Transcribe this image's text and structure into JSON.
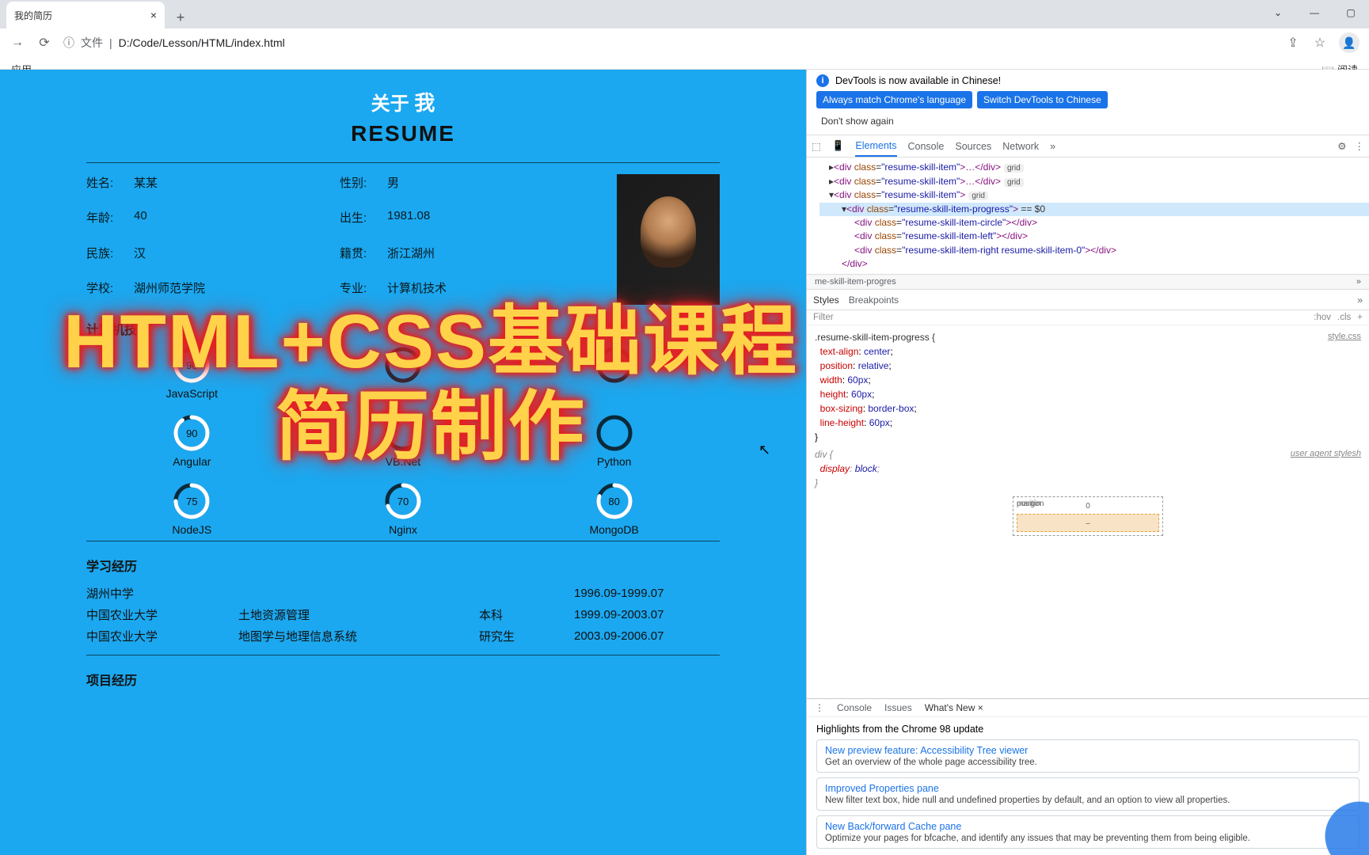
{
  "browser": {
    "tab_title": "我的简历",
    "url_prefix": "文件",
    "url_path": "D:/Code/Lesson/HTML/index.html",
    "bookmark_apps": "应用",
    "readlist": "阅读"
  },
  "resume": {
    "about_prefix": "关于",
    "about_me": "我",
    "title": "RESUME",
    "rows": [
      {
        "l1": "姓名:",
        "v1": "某某",
        "l2": "性别:",
        "v2": "男"
      },
      {
        "l1": "年龄:",
        "v1": "40",
        "l2": "出生:",
        "v2": "1981.08"
      },
      {
        "l1": "民族:",
        "v1": "汉",
        "l2": "籍贯:",
        "v2": "浙江湖州"
      },
      {
        "l1": "学校:",
        "v1": "湖州师范学院",
        "l2": "专业:",
        "v2": "计算机技术"
      }
    ],
    "skills_title": "计算机技能",
    "skills": [
      {
        "name": "JavaScript",
        "val": 90
      },
      {
        "name": "",
        "val": ""
      },
      {
        "name": "",
        "val": ""
      },
      {
        "name": "Angular",
        "val": 90
      },
      {
        "name": "VB.Net",
        "val": ""
      },
      {
        "name": "Python",
        "val": ""
      },
      {
        "name": "NodeJS",
        "val": 75
      },
      {
        "name": "Nginx",
        "val": 70
      },
      {
        "name": "MongoDB",
        "val": 80
      }
    ],
    "edu_title": "学习经历",
    "edu": [
      {
        "school": "湖州中学",
        "major": "",
        "degree": "",
        "period": "1996.09-1999.07"
      },
      {
        "school": "中国农业大学",
        "major": "土地资源管理",
        "degree": "本科",
        "period": "1999.09-2003.07"
      },
      {
        "school": "中国农业大学",
        "major": "地图学与地理信息系统",
        "degree": "研究生",
        "period": "2003.09-2006.07"
      }
    ],
    "proj_title": "项目经历"
  },
  "overlay": {
    "line1": "HTML+CSS基础课程",
    "line2": "简历制作"
  },
  "devtools": {
    "banner_msg": "DevTools is now available in Chinese!",
    "btn_always": "Always match Chrome's language",
    "btn_switch": "Switch DevTools to Chinese",
    "btn_dismiss": "Don't show again",
    "tabs": {
      "elements": "Elements",
      "console": "Console",
      "sources": "Sources",
      "network": "Network"
    },
    "dom": {
      "l1": "<div class=\"resume-skill-item\">…</div>",
      "l2": "<div class=\"resume-skill-item\">…</div>",
      "l3": "<div class=\"resume-skill-item\">",
      "l4": "<div class=\"resume-skill-item-progress\"> == $0",
      "l5": "<div class=\"resume-skill-item-circle\"></div>",
      "l6": "<div class=\"resume-skill-item-left\"></div>",
      "l7": "<div class=\"resume-skill-item-right resume-skill-item-0\"></div>",
      "l8": "</div>",
      "pill": "grid"
    },
    "crumbs": "me-skill-item-progres",
    "styles_tabs": {
      "styles": "Styles",
      "bp": "Breakpoints"
    },
    "filter": "Filter",
    "hov": ":hov",
    "cls": ".cls",
    "rule": {
      "selector": ".resume-skill-item-progress {",
      "src": "style.css",
      "p1": "text-align",
      "v1": "center",
      "p2": "position",
      "v2": "relative",
      "p3": "width",
      "v3": "60px",
      "p4": "height",
      "v4": "60px",
      "p5": "box-sizing",
      "v5": "border-box",
      "p6": "line-height",
      "v6": "60px"
    },
    "ua_rule": {
      "selector": "div {",
      "src": "user agent stylesh",
      "p1": "display",
      "v1": "block"
    },
    "box": {
      "position": "position",
      "pos_val": "0",
      "margin": "margin"
    },
    "drawer": {
      "console": "Console",
      "issues": "Issues",
      "whatsnew": "What's New",
      "headline": "Highlights from the Chrome 98 update",
      "c1t": "New preview feature: Accessibility Tree viewer",
      "c1d": "Get an overview of the whole page accessibility tree.",
      "c2t": "Improved Properties pane",
      "c2d": "New filter text box, hide null and undefined properties by default, and an option to view all properties.",
      "c3t": "New Back/forward Cache pane",
      "c3d": "Optimize your pages for bfcache, and identify any issues that may be preventing them from being eligible."
    }
  }
}
